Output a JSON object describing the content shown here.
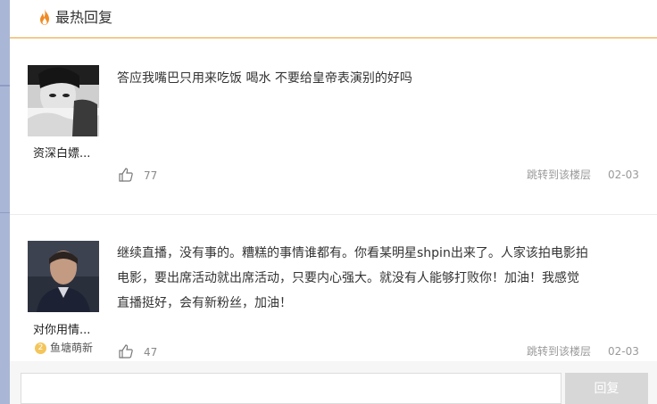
{
  "header": {
    "title": "最热回复",
    "icon": "fire-icon",
    "accent_color": "#f0a030"
  },
  "replies": [
    {
      "username": "资深白嫖...",
      "content": "答应我嘴巴只用来吃饭 喝水 不要给皇帝表演别的好吗",
      "likes": "77",
      "jump_label": "跳转到该楼层",
      "date": "02-03"
    },
    {
      "username": "对你用情...",
      "badge_level": "2",
      "badge": "鱼塘萌新",
      "content_lines": [
        "继续直播，没有事的。糟糕的事情谁都有。你看某明星shpin出来了。人家该拍电影拍",
        "电影，要出席活动就出席活动，只要内心强大。就没有人能够打败你！加油！我感觉",
        "直播挺好，会有新粉丝，加油！"
      ],
      "likes": "47",
      "jump_label": "跳转到该楼层",
      "date": "02-03"
    }
  ],
  "footer": {
    "input_placeholder": "",
    "reply_button": "回复"
  }
}
